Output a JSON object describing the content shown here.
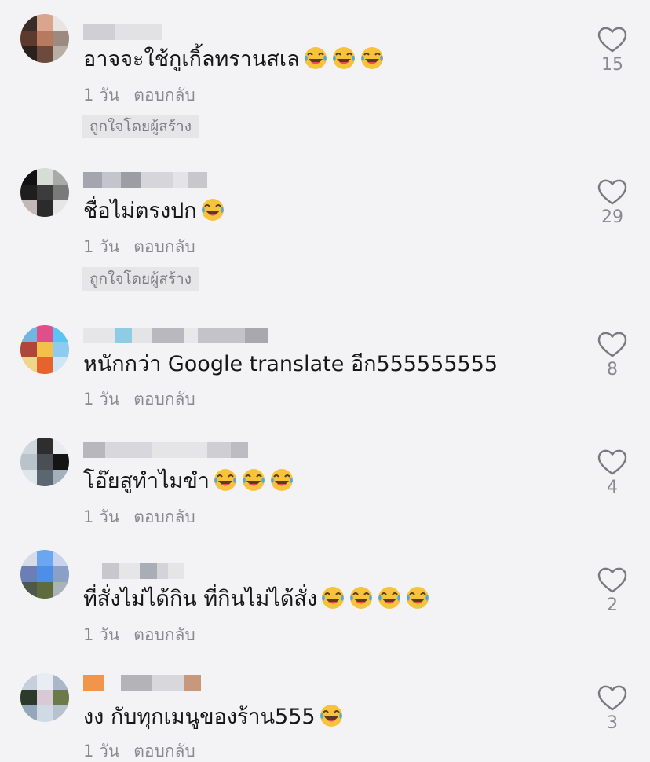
{
  "comments": [
    {
      "text": "อาจจะใช้กูเกิ้ลทรานสเล",
      "emoji_count": 3,
      "time": "1 วัน",
      "reply_label": "ตอบกลับ",
      "liked_by_creator": "ถูกใจโดยผู้สร้าง",
      "like_count": "15"
    },
    {
      "text": "ชื่อไม่ตรงปก",
      "emoji_count": 1,
      "time": "1 วัน",
      "reply_label": "ตอบกลับ",
      "liked_by_creator": "ถูกใจโดยผู้สร้าง",
      "like_count": "29"
    },
    {
      "text": "หนักกว่า Google translate อีก555555555",
      "emoji_count": 0,
      "time": "1 วัน",
      "reply_label": "ตอบกลับ",
      "like_count": "8"
    },
    {
      "text": "โอ๊ยสูทำไมขำ",
      "emoji_count": 3,
      "time": "1 วัน",
      "reply_label": "ตอบกลับ",
      "like_count": "4"
    },
    {
      "text": "ที่สั่งไม่ได้กิน ที่กินไม่ได้สั่ง",
      "emoji_count": 4,
      "time": "1 วัน",
      "reply_label": "ตอบกลับ",
      "like_count": "2"
    },
    {
      "text": "งง กับทุกเมนูของร้าน555",
      "emoji_count": 1,
      "time": "1 วัน",
      "reply_label": "ตอบกลับ",
      "like_count": "3"
    }
  ],
  "icons": {
    "like": "heart-outline-icon",
    "emoji": "face-with-tears-of-joy-icon"
  },
  "colors": {
    "text": "#161616",
    "meta": "#8a8a8e",
    "badge_bg": "#e6e6e8",
    "background": "#f3f3f5"
  }
}
